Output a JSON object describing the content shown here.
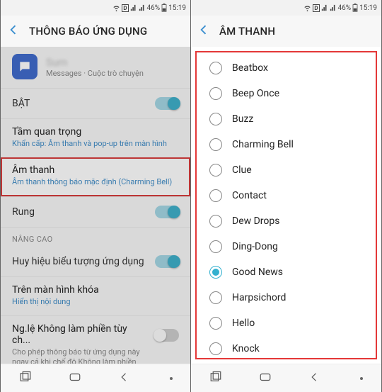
{
  "status": {
    "battery": "46%",
    "time": "15:19"
  },
  "left": {
    "header": "THÔNG BÁO ỨNG DỤNG",
    "app_name": "Sum",
    "app_sub": "Messages · Cuộc trò chuyện",
    "on_label": "BẬT",
    "importance_title": "Tầm quan trọng",
    "importance_sub": "Khẩn cấp: Âm thanh và pop-up trên màn hình",
    "sound_title": "Âm thanh",
    "sound_sub": "Âm thanh thông báo mặc định (Charming Bell)",
    "vibrate_label": "Rung",
    "advanced_header": "NÂNG CAO",
    "badge_label": "Huy hiệu biểu tượng ứng dụng",
    "lockscreen_title": "Trên màn hình khóa",
    "lockscreen_sub": "Hiển thị nội dung",
    "dnd_title": "Ng.lệ Không làm phiền tùy ch...",
    "dnd_sub": "Cho phép thông báo từ ứng dụng này ngay cả khi chế độ Không làm phiền được cài đặt cho các ứng dụng ngoại lệ tùy chỉnh."
  },
  "right": {
    "header": "ÂM THANH",
    "selected": "Good News",
    "sounds": [
      "Beatbox",
      "Beep Once",
      "Buzz",
      "Charming Bell",
      "Clue",
      "Contact",
      "Dew Drops",
      "Ding-Dong",
      "Good News",
      "Harpsichord",
      "Hello",
      "Knock"
    ]
  }
}
